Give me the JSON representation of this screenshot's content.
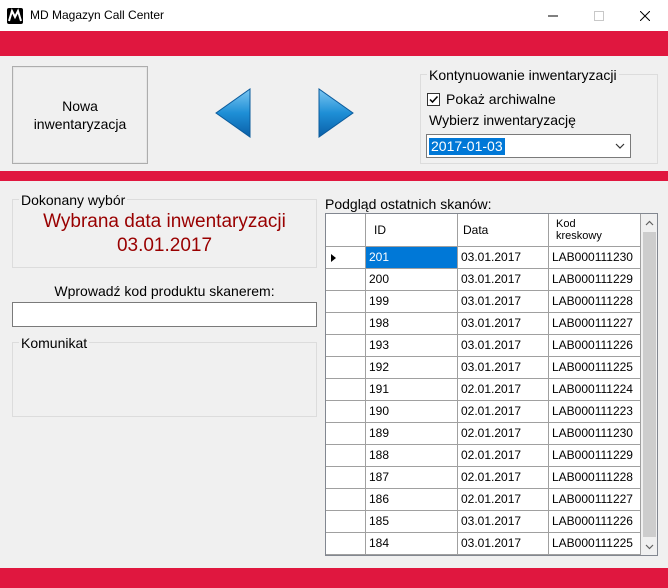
{
  "window": {
    "title": "MD Magazyn Call Center",
    "icon": "app-logo-icon",
    "controls": [
      "minimize-icon",
      "maximize-icon",
      "close-icon"
    ]
  },
  "colors": {
    "accent_red": "#e0173f",
    "selection_blue": "#0078d7",
    "choice_text": "#990000",
    "arrow_blue": "#1e8fd6"
  },
  "toolbar": {
    "new_inventory_label": "Nowa\ninwentaryzacja",
    "prev_icon": "arrow-left-icon",
    "next_icon": "arrow-right-icon"
  },
  "continue_panel": {
    "title": "Kontynuowanie inwentaryzacji",
    "show_archived_label": "Pokaż archiwalne",
    "show_archived_checked": true,
    "select_label": "Wybierz inwentaryzację",
    "selected_date": "2017-01-03"
  },
  "choice_panel": {
    "title": "Dokonany wybór",
    "line1": "Wybrana data inwentaryzacji",
    "line2": "03.01.2017"
  },
  "scan": {
    "label": "Wprowadź kod produktu skanerem:",
    "value": ""
  },
  "message_panel": {
    "title": "Komunikat",
    "text": ""
  },
  "preview": {
    "label": "Podgląd ostatnich skanów:",
    "columns": [
      "ID",
      "Data",
      "Kod\nkreskowy"
    ],
    "rows": [
      [
        "201",
        "03.01.2017",
        "LAB000111230"
      ],
      [
        "200",
        "03.01.2017",
        "LAB000111229"
      ],
      [
        "199",
        "03.01.2017",
        "LAB000111228"
      ],
      [
        "198",
        "03.01.2017",
        "LAB000111227"
      ],
      [
        "193",
        "03.01.2017",
        "LAB000111226"
      ],
      [
        "192",
        "03.01.2017",
        "LAB000111225"
      ],
      [
        "191",
        "02.01.2017",
        "LAB000111224"
      ],
      [
        "190",
        "02.01.2017",
        "LAB000111223"
      ],
      [
        "189",
        "02.01.2017",
        "LAB000111230"
      ],
      [
        "188",
        "02.01.2017",
        "LAB000111229"
      ],
      [
        "187",
        "02.01.2017",
        "LAB000111228"
      ],
      [
        "186",
        "02.01.2017",
        "LAB000111227"
      ],
      [
        "185",
        "03.01.2017",
        "LAB000111226"
      ],
      [
        "184",
        "03.01.2017",
        "LAB000111225"
      ]
    ],
    "selected_row": 0
  }
}
